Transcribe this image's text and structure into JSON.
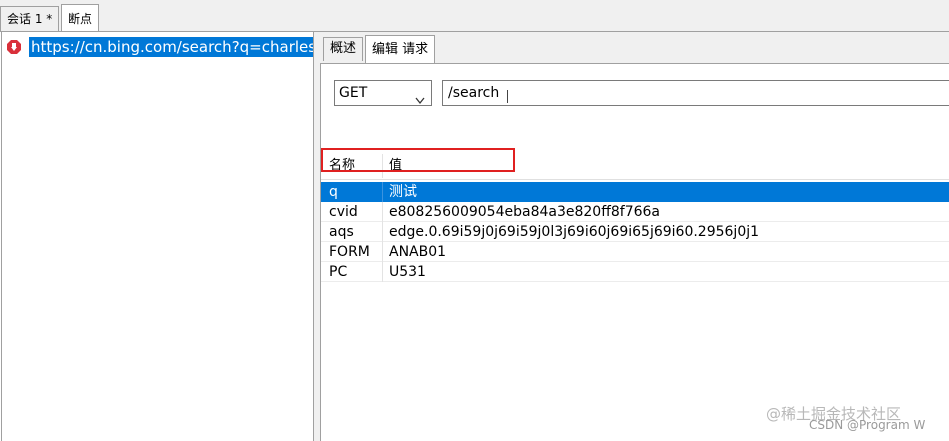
{
  "doc_tabs": [
    {
      "label": "会话 1 *",
      "active": false
    },
    {
      "label": "断点",
      "active": true
    }
  ],
  "breakpoint": {
    "icon": "breakpoint-icon",
    "url": "https://cn.bing.com/search?q=charles&"
  },
  "editor_tabs": [
    {
      "label": "概述",
      "active": false
    },
    {
      "label": "编辑 请求",
      "active": true
    }
  ],
  "request": {
    "method": "GET",
    "path": "/search"
  },
  "params": {
    "headers": {
      "name": "名称",
      "value": "值"
    },
    "rows": [
      {
        "name": "q",
        "value": "测试",
        "selected": true
      },
      {
        "name": "cvid",
        "value": "e808256009054eba84a3e820ff8f766a",
        "selected": false
      },
      {
        "name": "aqs",
        "value": "edge.0.69i59j0j69i59j0l3j69i60j69i65j69i60.2956j0j1",
        "selected": false
      },
      {
        "name": "FORM",
        "value": "ANAB01",
        "selected": false
      },
      {
        "name": "PC",
        "value": "U531",
        "selected": false
      }
    ]
  },
  "watermark": {
    "line1": "@稀土掘金技术社区",
    "line2": "CSDN @Program W"
  },
  "colors": {
    "selection": "#0078d7",
    "highlight_box": "#e02020",
    "breakpoint_icon": "#d9303a"
  }
}
